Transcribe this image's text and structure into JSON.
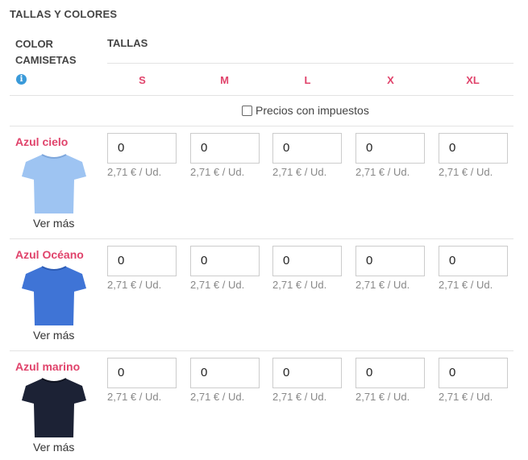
{
  "section_title": "TALLAS Y COLORES",
  "header": {
    "color_col": "COLOR CAMISETAS",
    "sizes_col": "TALLAS",
    "info_icon": "info-icon"
  },
  "sizes": [
    "S",
    "M",
    "L",
    "X",
    "XL"
  ],
  "tax_toggle": {
    "label": "Precios con impuestos",
    "checked": false
  },
  "colors": [
    {
      "name": "Azul cielo",
      "shirt_color": "#9ec4f2",
      "link": "Ver más",
      "qty": [
        "0",
        "0",
        "0",
        "0",
        "0"
      ],
      "price": "2,71 € / Ud."
    },
    {
      "name": "Azul Océano",
      "shirt_color": "#3f74d6",
      "link": "Ver más",
      "qty": [
        "0",
        "0",
        "0",
        "0",
        "0"
      ],
      "price": "2,71 € / Ud."
    },
    {
      "name": "Azul marino",
      "shirt_color": "#1c2235",
      "link": "Ver más",
      "qty": [
        "0",
        "0",
        "0",
        "0",
        "0"
      ],
      "price": "2,71 € / Ud."
    }
  ],
  "accent_color": "#e0436b"
}
